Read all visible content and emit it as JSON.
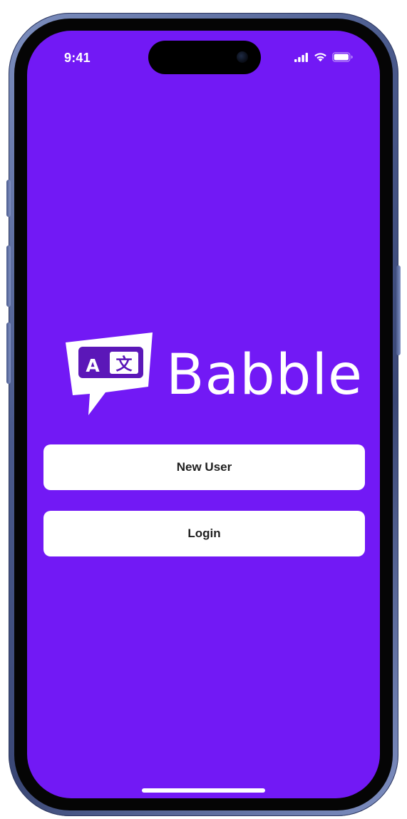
{
  "colors": {
    "screen_background": "#7219F5",
    "logo_badge": "#5B17B8",
    "button_background": "#FFFFFF",
    "button_text": "#1F1F1F",
    "frame": "#4A5A8C"
  },
  "status_bar": {
    "time": "9:41",
    "icons": [
      "cellular-signal-icon",
      "wifi-icon",
      "battery-icon"
    ]
  },
  "brand": {
    "name": "Babble",
    "logo_icon": "translate-speech-bubble-icon",
    "logo_glyph_latin": "A",
    "logo_glyph_cjk": "文"
  },
  "actions": {
    "new_user_label": "New User",
    "login_label": "Login"
  }
}
